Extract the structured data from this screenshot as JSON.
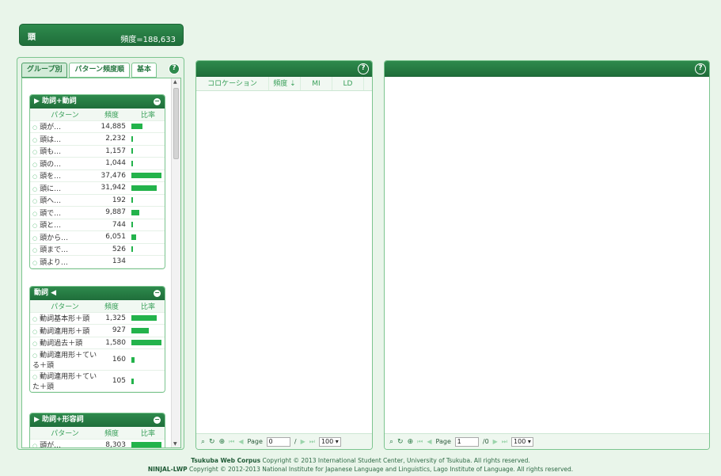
{
  "headword": {
    "word": "頭",
    "freq": "頻度=188,633"
  },
  "left": {
    "tabs": [
      "グループ別",
      "パターン頻度順",
      "基本"
    ],
    "help": "?",
    "columns": {
      "pattern": "パターン",
      "freq": "頻度",
      "ratio": "比率"
    },
    "groups": [
      {
        "title": "▶ 助詞+動詞",
        "toggle": "−",
        "rows": [
          {
            "p": "頭が…",
            "f": "14,885",
            "r": 0.36
          },
          {
            "p": "頭は…",
            "f": "2,232",
            "r": 0.05
          },
          {
            "p": "頭も…",
            "f": "1,157",
            "r": 0.03
          },
          {
            "p": "頭の…",
            "f": "1,044",
            "r": 0.03
          },
          {
            "p": "頭を…",
            "f": "37,476",
            "r": 1.0
          },
          {
            "p": "頭に…",
            "f": "31,942",
            "r": 0.85
          },
          {
            "p": "頭へ…",
            "f": "192",
            "r": 0.01
          },
          {
            "p": "頭で…",
            "f": "9,887",
            "r": 0.26
          },
          {
            "p": "頭と…",
            "f": "744",
            "r": 0.02
          },
          {
            "p": "頭から…",
            "f": "6,051",
            "r": 0.16
          },
          {
            "p": "頭まで…",
            "f": "526",
            "r": 0.01
          },
          {
            "p": "頭より…",
            "f": "134",
            "r": 0.0
          }
        ]
      },
      {
        "title": "動詞 ◀",
        "toggle": "−",
        "rows": [
          {
            "p": "動詞基本形＋頭",
            "f": "1,325",
            "r": 0.84
          },
          {
            "p": "動詞連用形＋頭",
            "f": "927",
            "r": 0.59
          },
          {
            "p": "動詞過去＋頭",
            "f": "1,580",
            "r": 1.0
          },
          {
            "p": "動詞連用形＋ている＋頭",
            "f": "160",
            "r": 0.1
          },
          {
            "p": "動詞連用形＋ていた＋頭",
            "f": "105",
            "r": 0.07
          }
        ]
      },
      {
        "title": "▶ 助詞+形容詞",
        "toggle": "−",
        "rows": [
          {
            "p": "頭が…",
            "f": "8,303",
            "r": 1.0
          }
        ]
      }
    ]
  },
  "mid": {
    "help": "?",
    "columns": [
      "コロケーション",
      "頻度 ⇣",
      "MI",
      "LD"
    ],
    "pager": {
      "page_label": "Page",
      "page_value": "0",
      "of": "/",
      "page_size": "100"
    }
  },
  "right": {
    "help": "?",
    "pager": {
      "page_label": "Page",
      "page_value": "1",
      "of": "/0",
      "page_size": "100"
    }
  },
  "footer": {
    "line1_brand": "Tsukuba Web Corpus",
    "line1_rest": " Copyright © 2013 International Student Center, University of Tsukuba. All rights reserved.",
    "line2_brand": "NINJAL-LWP",
    "line2_rest": " Copyright © 2012-2013 National Institute for Japanese Language and Linguistics, Lago Institute of Language. All rights reserved."
  }
}
